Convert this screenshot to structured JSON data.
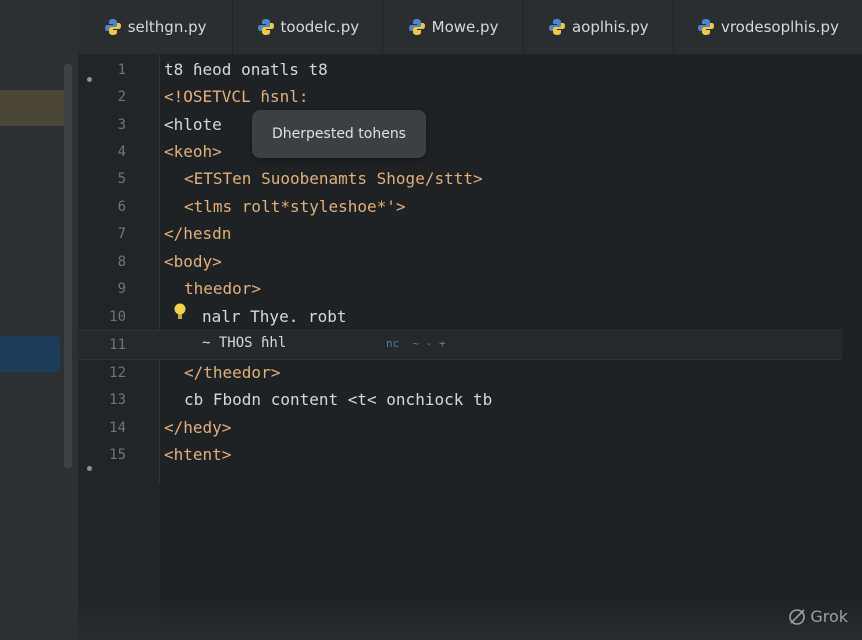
{
  "tabs": [
    {
      "label": "selthgn.py"
    },
    {
      "label": "toodelc.py"
    },
    {
      "label": "Mowe.py"
    },
    {
      "label": "aoplhis.py"
    },
    {
      "label": "vrodesoplhis.py"
    }
  ],
  "gutter": {
    "line_numbers": [
      "1",
      "2",
      "3",
      "4",
      "5",
      "6",
      "7",
      "8",
      "9",
      "10",
      "11",
      "12",
      "13",
      "14",
      "15"
    ]
  },
  "code": {
    "lines": [
      "t8 ɦeod onatls t8",
      "<!OSETVCL ɦsnl:",
      "<hlote",
      "<keoh>",
      "<ETSTen Suoobenamts Shoge/sttt>",
      "<tlms rolt*styleshoe*'>",
      "</hesdn",
      "<body>",
      "theedor>",
      "nalr Thye. robt",
      "~ THOS ɦhl",
      "</theedor>",
      "cb Fbodn content <t< onchiock tb",
      "</hedy>",
      "<htent>"
    ],
    "line11_trailing": "nc  ~ - +"
  },
  "tooltip": {
    "text": "Dherpested tohens"
  },
  "watermark": {
    "text": "Grok"
  },
  "colors": {
    "background": "#1f2225",
    "tag": "#e2b07a",
    "text": "#d8d8d8",
    "line_number": "#6f757b"
  }
}
